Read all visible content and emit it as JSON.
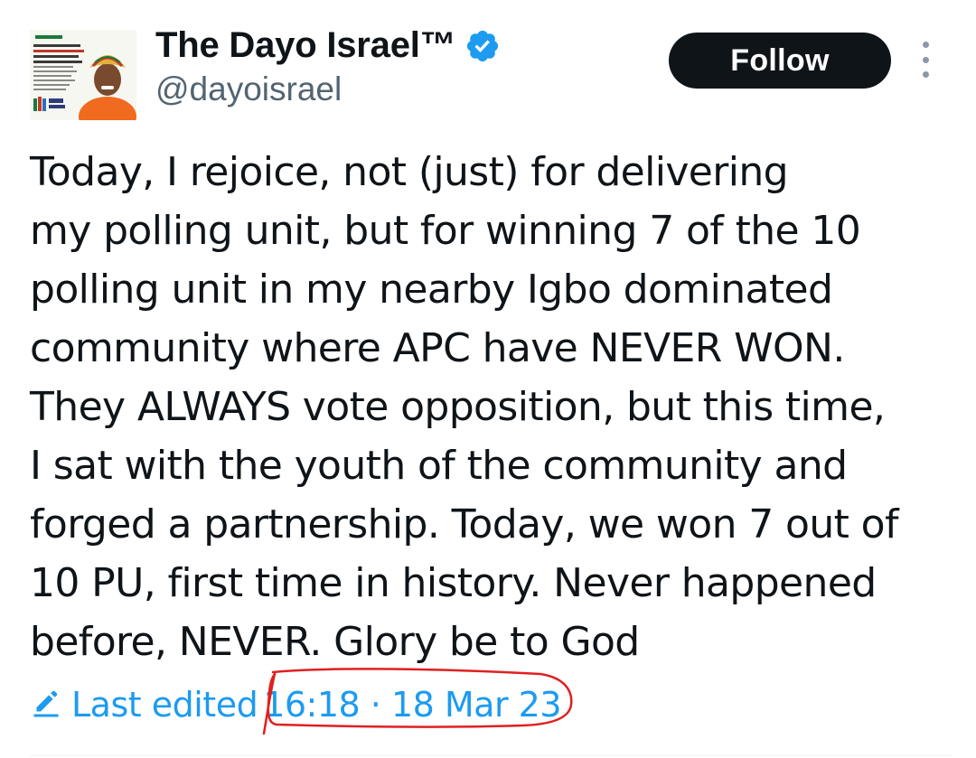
{
  "author": {
    "display_name": "The Dayo Israel™",
    "handle": "@dayoisrael",
    "verified": true,
    "verified_color": "#1d9bf0",
    "avatar_icon": "profile-photo-with-campaign-poster"
  },
  "follow_label": "Follow",
  "more_icon": "more-vertical-icon",
  "tweet": {
    "lines": [
      "Today, I rejoice, not (just) for delivering",
      "my polling unit, but for winning 7 of the 10",
      "polling unit in my nearby Igbo dominated",
      "community where APC have NEVER WON.",
      "They ALWAYS vote opposition, but this time,",
      "I sat with the youth of the community and",
      "forged a partnership. Today, we won 7 out of",
      "10 PU, first time in history. Never happened",
      "before, NEVER. Glory be to God"
    ]
  },
  "meta": {
    "edit_icon": "pencil-edit-icon",
    "last_edited_label": "Last edited",
    "timestamp": "16:18 · 18 Mar 23",
    "link_color": "#1d9bf0",
    "annotation_color": "#e02020"
  }
}
